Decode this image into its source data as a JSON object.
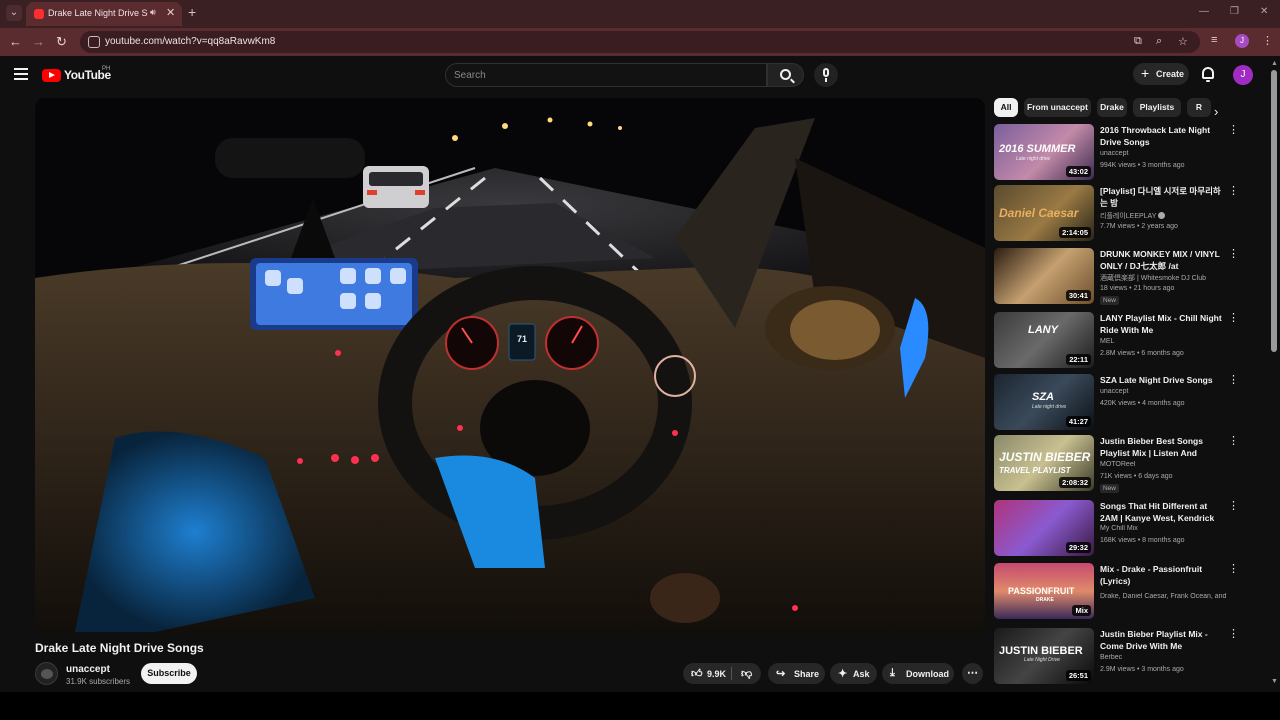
{
  "browser": {
    "tab": {
      "title": "Drake Late Night Drive Songs"
    },
    "url": "youtube.com/watch?v=qq8aRavwKm8",
    "profile_initial": "J"
  },
  "header": {
    "logo_text": "YouTube",
    "country_code": "PH",
    "search_placeholder": "Search",
    "create_label": "Create",
    "avatar_initial": "J"
  },
  "video": {
    "title": "Drake Late Night Drive Songs",
    "channel": "unaccept",
    "subscribers": "31.9K subscribers",
    "subscribe_label": "Subscribe",
    "likes": "9.9K",
    "share_label": "Share",
    "ask_label": "Ask",
    "download_label": "Download",
    "dash_speed": "71"
  },
  "chips": [
    "All",
    "From unaccept",
    "Drake",
    "Playlists",
    "R"
  ],
  "recommendations": [
    {
      "title": "2016 Throwback Late Night Drive Songs",
      "channel": "unaccept",
      "meta": "994K views • 3 months ago",
      "duration": "43:02",
      "thumb_text": "2016 SUMMER",
      "thumb_sub": "Late night drive",
      "colors": [
        "#7a5f9c",
        "#c38aa9",
        "#3b2b4d"
      ]
    },
    {
      "title": "[Playlist] 다니엘 시저로 마무리하는 밤",
      "channel": "리플레이LEEPLAY",
      "meta": "7.7M views • 2 years ago",
      "duration": "2:14:05",
      "thumb_text": "Daniel Caesar",
      "thumb_sub": "",
      "colors": [
        "#5a4a2e",
        "#9a7a44",
        "#2a2418"
      ]
    },
    {
      "title": "DRUNK MONKEY MIX / VINYL ONLY / DJ七太郎 /at TATSUPI…",
      "channel": "酒蔵倶楽部 | Whitesmoke DJ Club",
      "meta": "18 views • 21 hours ago",
      "duration": "30:41",
      "badge": "New",
      "thumb_text": "",
      "thumb_sub": "",
      "colors": [
        "#6a4e2c",
        "#c5a070",
        "#2a1d12"
      ]
    },
    {
      "title": "LANY Playlist Mix - Chill Night Ride With Me",
      "channel": "MEL",
      "meta": "2.8M views • 6 months ago",
      "duration": "22:11",
      "thumb_text": "LANY",
      "thumb_sub": "",
      "colors": [
        "#3a3a3a",
        "#6a6a6a",
        "#1c1c1c"
      ]
    },
    {
      "title": "SZA Late Night Drive Songs",
      "channel": "unaccept",
      "meta": "420K views • 4 months ago",
      "duration": "41:27",
      "thumb_text": "SZA",
      "thumb_sub": "Late night drive",
      "colors": [
        "#1c2530",
        "#3a4a5a",
        "#0c1016"
      ]
    },
    {
      "title": "Justin Bieber Best Songs Playlist Mix | Listen And Travel…",
      "channel": "MOTOReel",
      "meta": "71K views • 6 days ago",
      "duration": "2:08:32",
      "badge": "New",
      "thumb_text": "JUSTIN BIEBER",
      "thumb_sub": "TRAVEL PLAYLIST",
      "colors": [
        "#8a8a6a",
        "#c8c090",
        "#3a3a28"
      ]
    },
    {
      "title": "Songs That Hit Different at 2AM | Kanye West, Kendrick Lamar, …",
      "channel": "My Chill Mix",
      "meta": "168K views • 8 months ago",
      "duration": "29:32",
      "thumb_text": "",
      "thumb_sub": "",
      "colors": [
        "#b0337a",
        "#8a5ad0",
        "#3a1a40"
      ]
    },
    {
      "title": "Mix - Drake - Passionfruit (Lyrics)",
      "channel": "Drake, Daniel Caesar, Frank Ocean, and …",
      "meta": "",
      "duration": "Mix",
      "thumb_text": "PASSIONFRUIT",
      "thumb_sub": "DRAKE",
      "colors": [
        "#c44a70",
        "#e08a6a",
        "#3a2a5a"
      ]
    },
    {
      "title": "Justin Bieber Playlist Mix - Come Drive With Me",
      "channel": "Berbec",
      "meta": "2.9M views • 3 months ago",
      "duration": "26:51",
      "thumb_text": "JUSTIN BIEBER",
      "thumb_sub": "Late Night Drive",
      "colors": [
        "#1a1a1a",
        "#444444",
        "#0a0a0a"
      ]
    }
  ]
}
